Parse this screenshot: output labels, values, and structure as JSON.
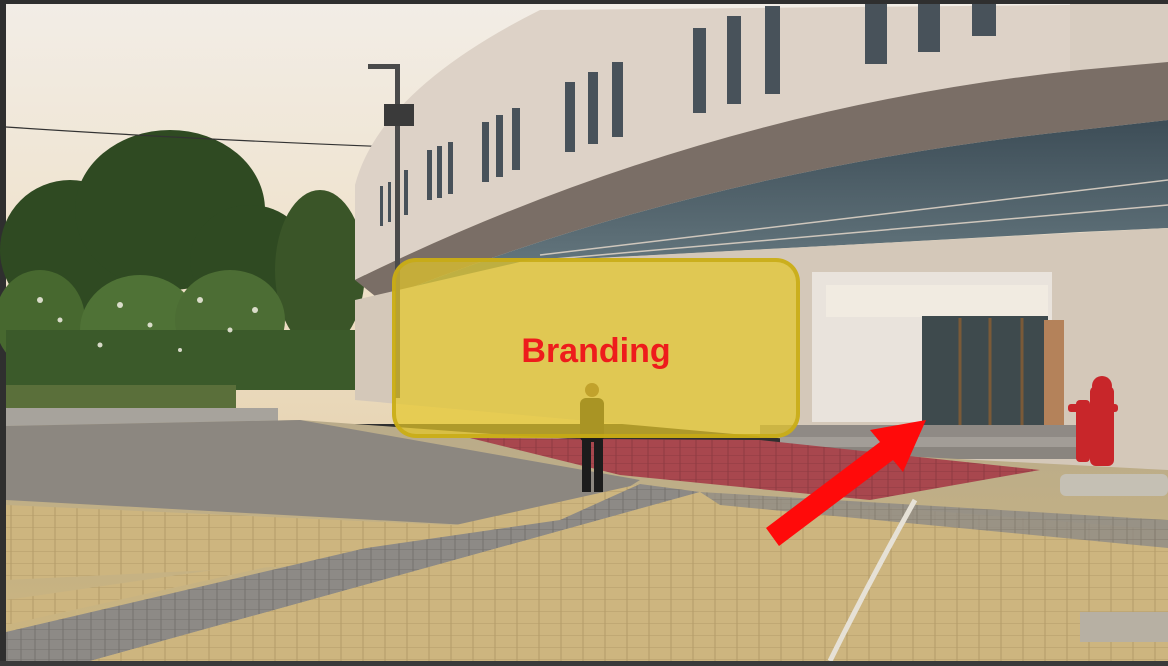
{
  "overlay": {
    "label": "Branding",
    "fill_color": "#e6c828",
    "text_color": "#ee1c1c"
  },
  "annotation": {
    "arrow_icon": "arrow-up-right-icon",
    "arrow_color": "#ff0a0a"
  },
  "scene": {
    "sky_color": "#e9e2cf",
    "building_color": "#ddd3c8",
    "paving_color": "#c9b383",
    "brick_path_color": "#a4454c"
  }
}
